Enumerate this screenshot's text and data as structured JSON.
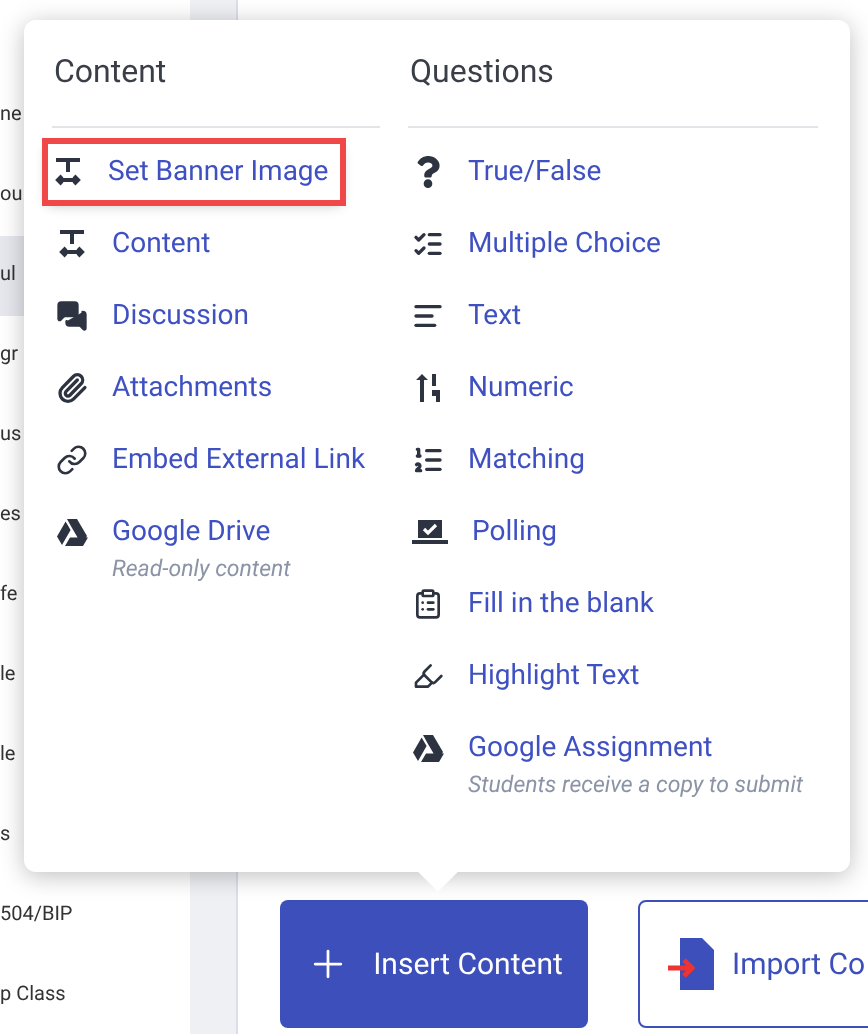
{
  "sidebar": {
    "items": [
      {
        "label": "ne",
        "selected": false
      },
      {
        "label": "ou",
        "selected": false
      },
      {
        "label": "ul",
        "selected": true
      },
      {
        "label": "gr",
        "selected": false
      },
      {
        "label": "us",
        "selected": false
      },
      {
        "label": "es",
        "selected": false
      },
      {
        "label": "fe",
        "selected": false
      },
      {
        "label": "le",
        "selected": false
      },
      {
        "label": "le",
        "selected": false
      },
      {
        "label": "s",
        "selected": false
      },
      {
        "label": "504/BIP",
        "selected": false
      },
      {
        "label": "p Class",
        "selected": false
      }
    ]
  },
  "menu": {
    "columns": [
      {
        "title": "Content",
        "items": [
          {
            "label": "Set Banner Image",
            "highlighted": true
          },
          {
            "label": "Content",
            "highlighted": false
          },
          {
            "label": "Discussion",
            "highlighted": false
          },
          {
            "label": "Attachments",
            "highlighted": false
          },
          {
            "label": "Embed External Link",
            "highlighted": false
          },
          {
            "label": "Google Drive",
            "subtitle": "Read-only content",
            "highlighted": false
          }
        ]
      },
      {
        "title": "Questions",
        "items": [
          {
            "label": "True/False",
            "highlighted": false
          },
          {
            "label": "Multiple Choice",
            "highlighted": false
          },
          {
            "label": "Text",
            "highlighted": false
          },
          {
            "label": "Numeric",
            "highlighted": false
          },
          {
            "label": "Matching",
            "highlighted": false
          },
          {
            "label": "Polling",
            "highlighted": false
          },
          {
            "label": "Fill in the blank",
            "highlighted": false
          },
          {
            "label": "Highlight Text",
            "highlighted": false
          },
          {
            "label": "Google Assignment",
            "subtitle": "Students receive a copy to submit",
            "highlighted": false
          }
        ]
      }
    ]
  },
  "buttons": [
    {
      "label": "Insert Content",
      "kind": "primary"
    },
    {
      "label": "Import Co",
      "kind": "outline"
    }
  ]
}
